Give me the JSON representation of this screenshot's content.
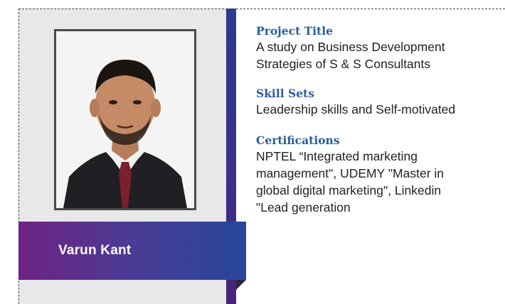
{
  "profile": {
    "name": "Varun Kant",
    "photo_alt": "portrait-photo"
  },
  "sections": {
    "project": {
      "heading": "Project Title",
      "lines": [
        "A study on Business Development",
        "Strategies of S & S Consultants"
      ]
    },
    "skills": {
      "heading": "Skill Sets",
      "lines": [
        "Leadership skills and Self-motivated"
      ]
    },
    "certifications": {
      "heading": "Certifications",
      "lines": [
        "NPTEL “Integrated marketing",
        "management\", UDEMY \"Master in",
        "global digital marketing\", Linkedin",
        "\"Lead generation"
      ]
    }
  },
  "colors": {
    "heading": "#2a5d9c",
    "ribbon_start": "#6e2383",
    "ribbon_end": "#26479a",
    "panel": "#e8e8ea"
  }
}
